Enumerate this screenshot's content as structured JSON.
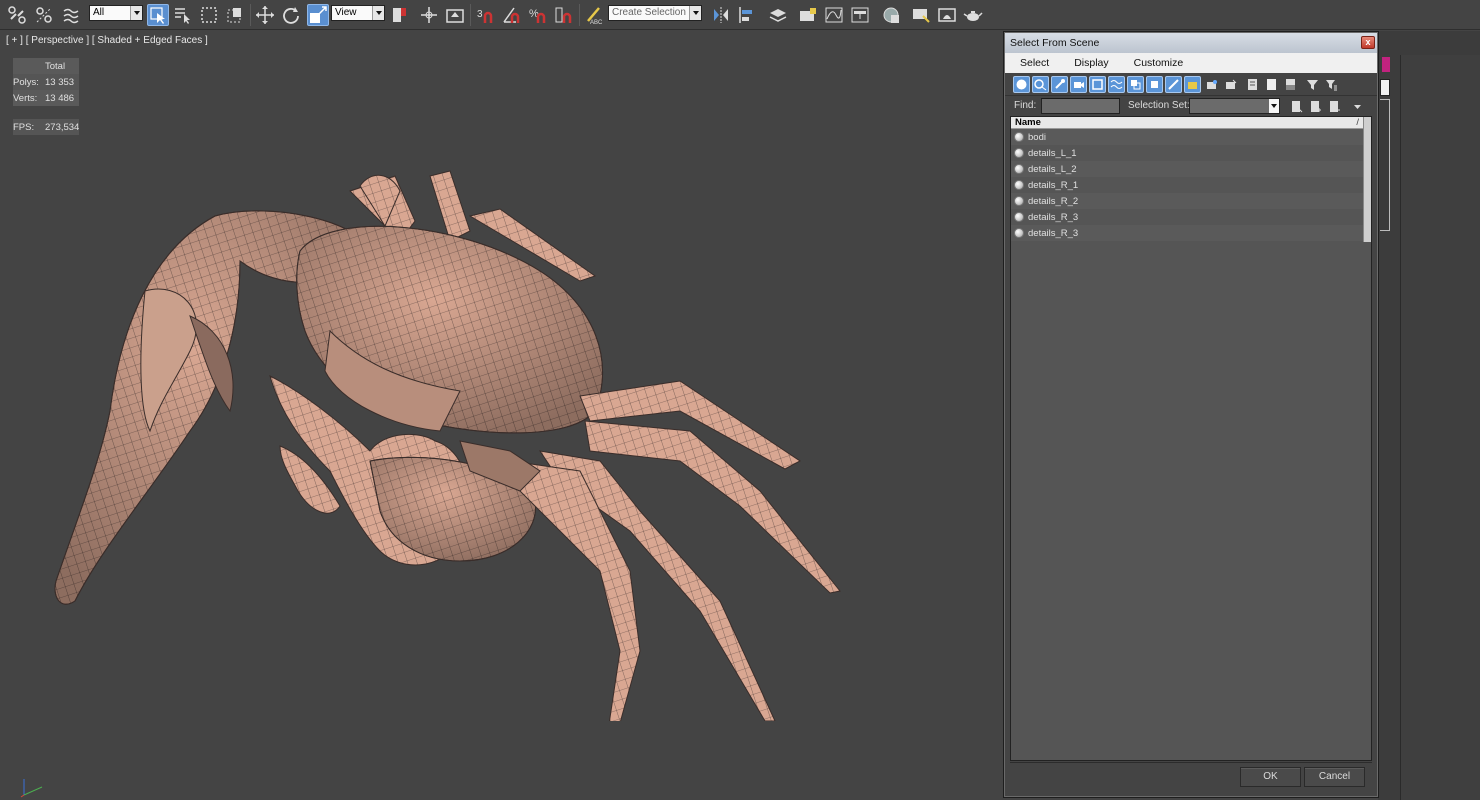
{
  "toolbar": {
    "selection_filter": "All",
    "reference_coord": "View",
    "named_selection_placeholder": "Create Selection Se",
    "snap_angle_label": "3",
    "snap_percent_label": "%"
  },
  "viewport": {
    "label": "[ + ] [ Perspective ] [ Shaded + Edged Faces ]",
    "stats": {
      "total_label": "Total",
      "polys_label": "Polys:",
      "polys_value": "13 353",
      "verts_label": "Verts:",
      "verts_value": "13 486",
      "fps_label": "FPS:",
      "fps_value": "273,534"
    }
  },
  "dialog": {
    "title": "Select From Scene",
    "close_glyph": "x",
    "menu": [
      "Select",
      "Display",
      "Customize"
    ],
    "find_label": "Find:",
    "find_value": "",
    "selection_set_label": "Selection Set:",
    "list_header": "Name",
    "sort_glyph": "/",
    "items": [
      "bodi",
      "details_L_1",
      "details_L_2",
      "details_R_1",
      "details_R_2",
      "details_R_3",
      "details_R_3"
    ],
    "ok_label": "OK",
    "cancel_label": "Cancel"
  },
  "colors": {
    "stats_text": "#f1d548",
    "highlight_blue": "#5b95d8",
    "mesh_fill": "#d9a792",
    "mesh_wire": "#4a3a36"
  }
}
